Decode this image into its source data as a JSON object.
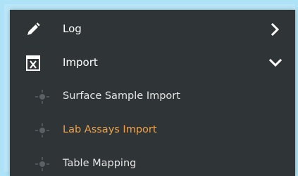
{
  "menu": {
    "items": [
      {
        "label": "Log",
        "icon": "pencil-icon",
        "chevron": "chevron-right-icon"
      },
      {
        "label": "Import",
        "icon": "excel-x-icon",
        "chevron": "chevron-down-icon"
      }
    ],
    "subitems": [
      {
        "label": "Surface Sample Import",
        "icon": "crosshair-dot-icon",
        "active": false
      },
      {
        "label": "Lab Assays Import",
        "icon": "crosshair-dot-icon",
        "active": true
      },
      {
        "label": "Table Mapping",
        "icon": "crosshair-dot-icon",
        "active": false
      }
    ]
  },
  "colors": {
    "panel_bg": "#2f3437",
    "frame_highlight": "#aee3f7",
    "text": "#ffffff",
    "active_text": "#f0a24a",
    "subicon": "#5a6064"
  }
}
